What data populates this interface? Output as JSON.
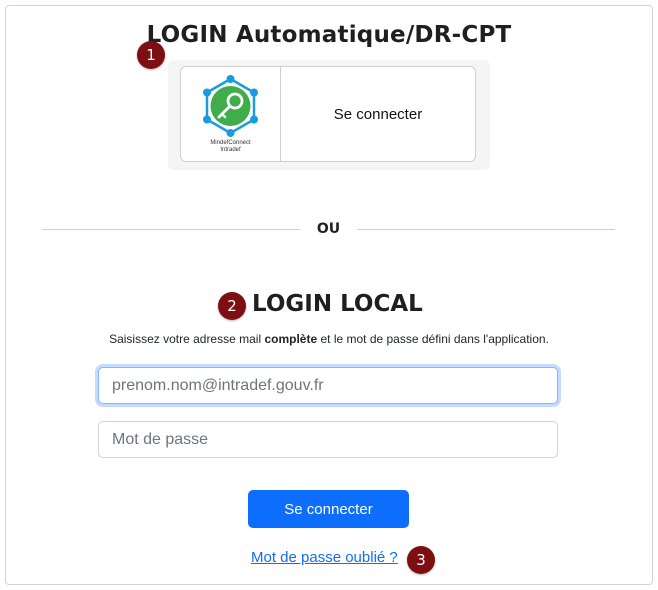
{
  "auto_login": {
    "title": "LOGIN Automatique/DR-CPT",
    "badge": "1",
    "logo_line_1": "MindefConnect",
    "logo_line_2": "Intradef",
    "button_label": "Se connecter"
  },
  "divider": {
    "label": "OU"
  },
  "local_login": {
    "title": "LOGIN LOCAL",
    "badge": "2",
    "instructions_before": "Saisissez votre adresse mail ",
    "instructions_bold": "complète",
    "instructions_after": " et le mot de passe défini dans l'application.",
    "email_placeholder": "prenom.nom@intradef.gouv.fr",
    "email_value": "",
    "password_placeholder": "Mot de passe",
    "password_value": "",
    "submit_label": "Se connecter",
    "forgot_label": "Mot de passe oublié ?",
    "forgot_badge": "3"
  },
  "colors": {
    "badge": "#7d0f12",
    "primary": "#0d6efd",
    "logo_green": "#3fae4a",
    "logo_blue": "#1a9be0"
  },
  "icons": {
    "logo": "mindefconnect-key-network-icon"
  }
}
